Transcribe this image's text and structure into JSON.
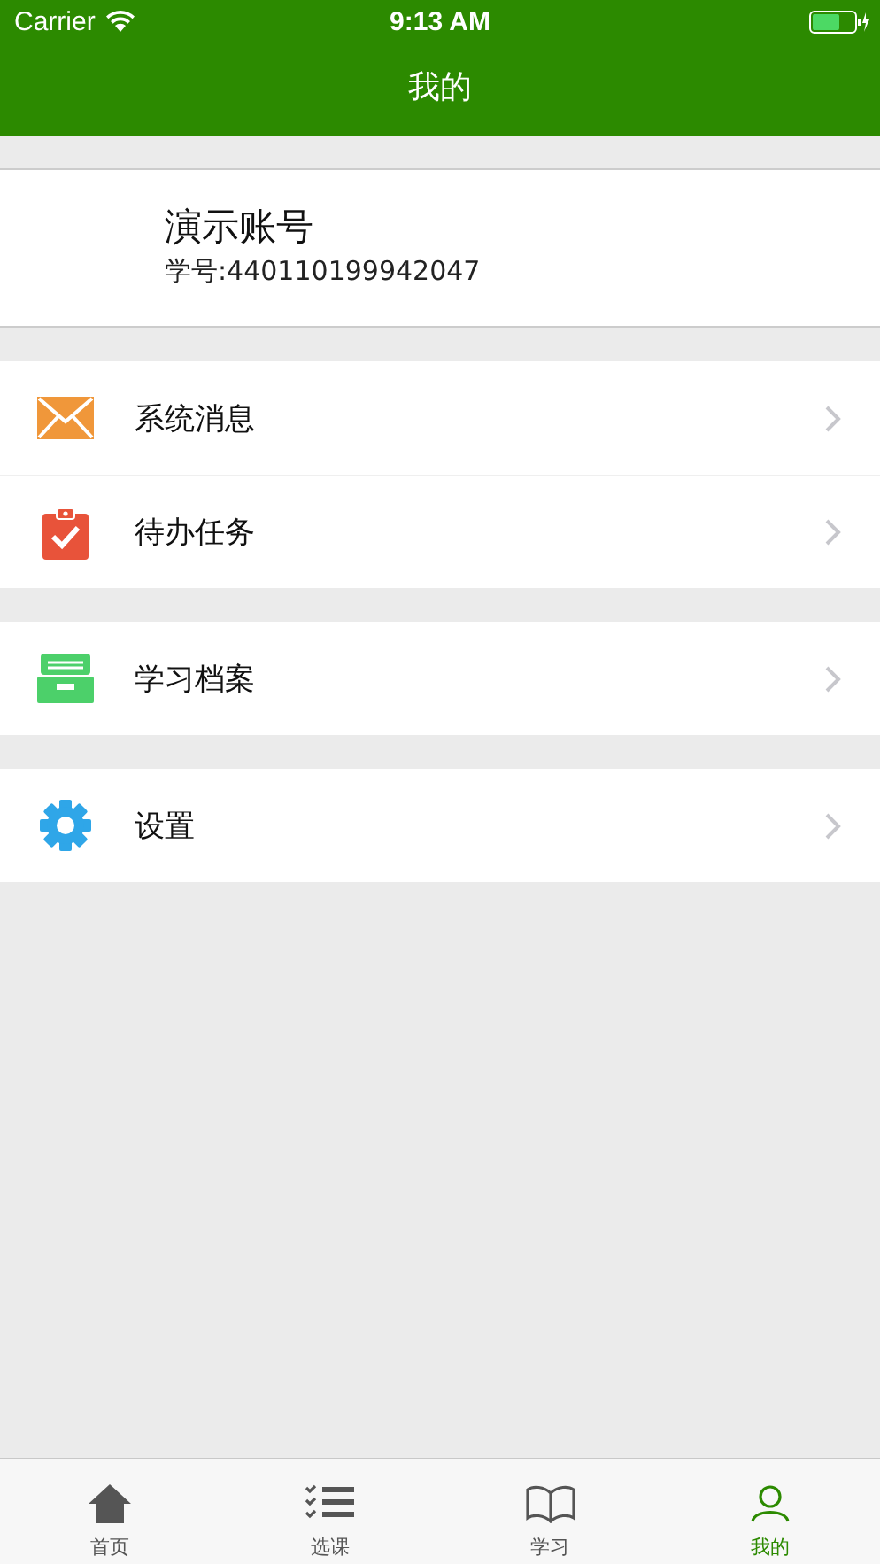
{
  "status_bar": {
    "carrier": "Carrier",
    "time": "9:13 AM"
  },
  "nav_bar": {
    "title": "我的"
  },
  "profile": {
    "name": "演示账号",
    "student_id": "学号:440110199942047"
  },
  "menu_groups": [
    {
      "items": [
        {
          "kind": "mail",
          "label": "系统消息"
        },
        {
          "kind": "task",
          "label": "待办任务"
        }
      ]
    },
    {
      "items": [
        {
          "kind": "archive",
          "label": "学习档案"
        }
      ]
    },
    {
      "items": [
        {
          "kind": "settings",
          "label": "设置"
        }
      ]
    }
  ],
  "tab_bar": [
    {
      "kind": "home",
      "label": "首页",
      "selected": false
    },
    {
      "kind": "courses",
      "label": "选课",
      "selected": false
    },
    {
      "kind": "study",
      "label": "学习",
      "selected": false
    },
    {
      "kind": "me",
      "label": "我的",
      "selected": true
    }
  ]
}
